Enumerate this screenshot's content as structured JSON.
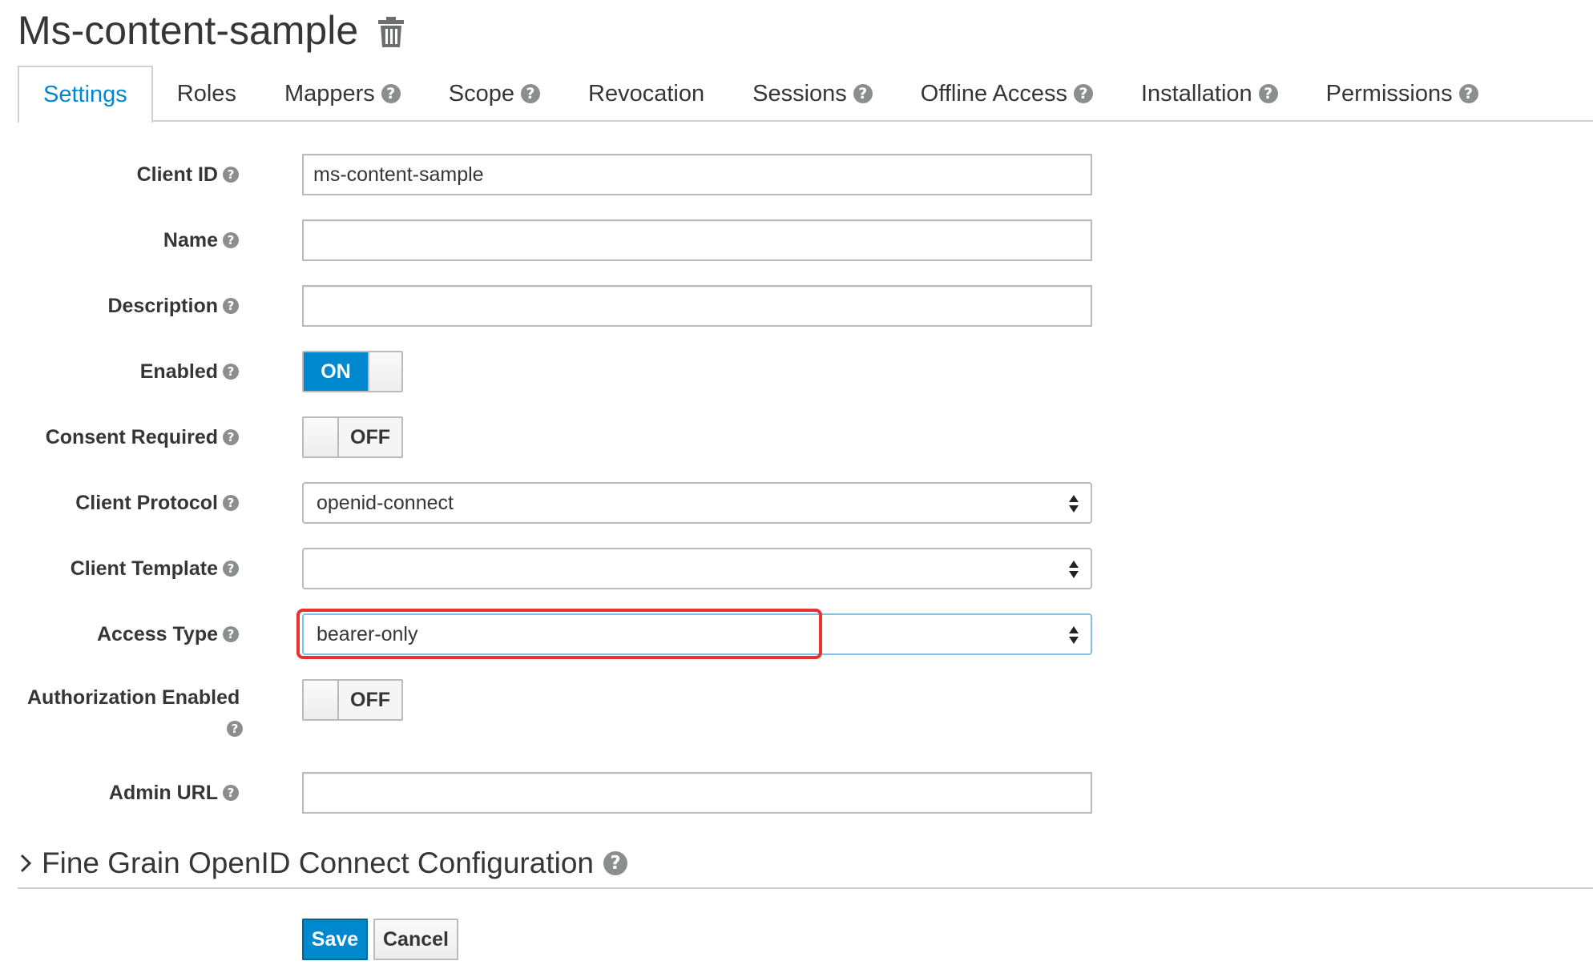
{
  "header": {
    "title": "Ms-content-sample"
  },
  "tabs": [
    {
      "label": "Settings",
      "help": false,
      "active": true
    },
    {
      "label": "Roles",
      "help": false
    },
    {
      "label": "Mappers",
      "help": true
    },
    {
      "label": "Scope",
      "help": true
    },
    {
      "label": "Revocation",
      "help": false
    },
    {
      "label": "Sessions",
      "help": true
    },
    {
      "label": "Offline Access",
      "help": true
    },
    {
      "label": "Installation",
      "help": true
    },
    {
      "label": "Permissions",
      "help": true
    }
  ],
  "form": {
    "client_id": {
      "label": "Client ID",
      "value": "ms-content-sample"
    },
    "name": {
      "label": "Name",
      "value": ""
    },
    "description": {
      "label": "Description",
      "value": ""
    },
    "enabled": {
      "label": "Enabled",
      "state": "ON"
    },
    "consent_required": {
      "label": "Consent Required",
      "state": "OFF"
    },
    "client_protocol": {
      "label": "Client Protocol",
      "value": "openid-connect"
    },
    "client_template": {
      "label": "Client Template",
      "value": ""
    },
    "access_type": {
      "label": "Access Type",
      "value": "bearer-only"
    },
    "authorization_enabled": {
      "label": "Authorization Enabled",
      "state": "OFF"
    },
    "admin_url": {
      "label": "Admin URL",
      "value": ""
    }
  },
  "fine_grain": {
    "title": "Fine Grain OpenID Connect Configuration"
  },
  "buttons": {
    "save": "Save",
    "cancel": "Cancel"
  },
  "icons": {
    "help": "?"
  },
  "colors": {
    "primary": "#0088ce",
    "highlight": "#e8332d",
    "text": "#363636"
  }
}
